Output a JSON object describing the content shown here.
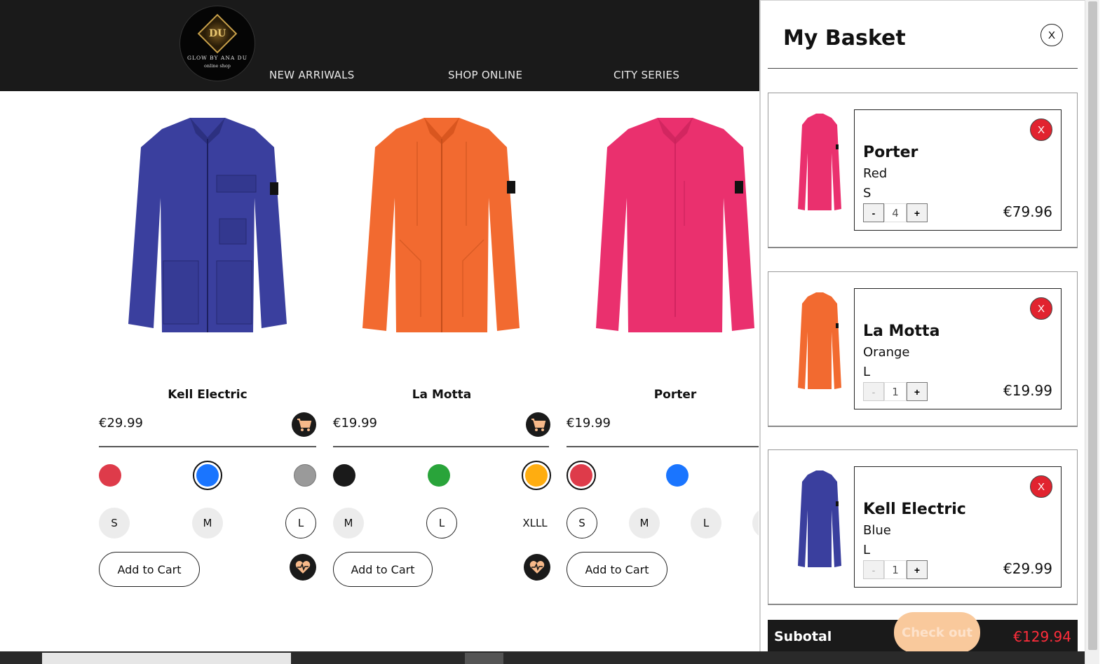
{
  "header": {
    "logo_name": "GLOW BY ANA DU",
    "logo_sub": "online shop",
    "logo_mark": "DU",
    "nav": [
      "NEW ARRIWALS",
      "SHOP ONLINE",
      "CITY SERIES"
    ]
  },
  "products": [
    {
      "name": "Kell Electric",
      "price": "€29.99",
      "color": "#3a3f9e",
      "swatches": [
        "#de3b4a",
        "#1a75ff",
        "#9a9a9a"
      ],
      "sizes": [
        "S",
        "M",
        "L"
      ],
      "add_label": "Add to Cart"
    },
    {
      "name": "La Motta",
      "price": "€19.99",
      "color": "#f26a30",
      "swatches": [
        "#1a1a1a",
        "#29a43a",
        "#ffad10"
      ],
      "sizes": [
        "M",
        "L",
        "XLLL"
      ],
      "add_label": "Add to Cart"
    },
    {
      "name": "Porter",
      "price": "€19.99",
      "color": "#ea306e",
      "swatches": [
        "#de3b4a",
        "#1a75ff"
      ],
      "sizes": [
        "S",
        "M",
        "L"
      ],
      "add_label": "Add to Cart"
    }
  ],
  "basket": {
    "title": "My Basket",
    "close_label": "X",
    "items": [
      {
        "name": "Porter",
        "color": "Red",
        "size": "S",
        "qty": "4",
        "price": "€79.96",
        "thumb_color": "#ea306e",
        "remove": "X",
        "minus": "-",
        "plus": "+"
      },
      {
        "name": "La Motta",
        "color": "Orange",
        "size": "L",
        "qty": "1",
        "price": "€19.99",
        "thumb_color": "#f26a30",
        "remove": "X",
        "minus": "-",
        "plus": "+"
      },
      {
        "name": "Kell Electric",
        "color": "Blue",
        "size": "L",
        "qty": "1",
        "price": "€29.99",
        "thumb_color": "#3a3f9e",
        "remove": "X",
        "minus": "-",
        "plus": "+"
      }
    ],
    "subtotal_label": "Subotal",
    "subtotal_value": "€129.94",
    "checkout_label": "Check out"
  }
}
